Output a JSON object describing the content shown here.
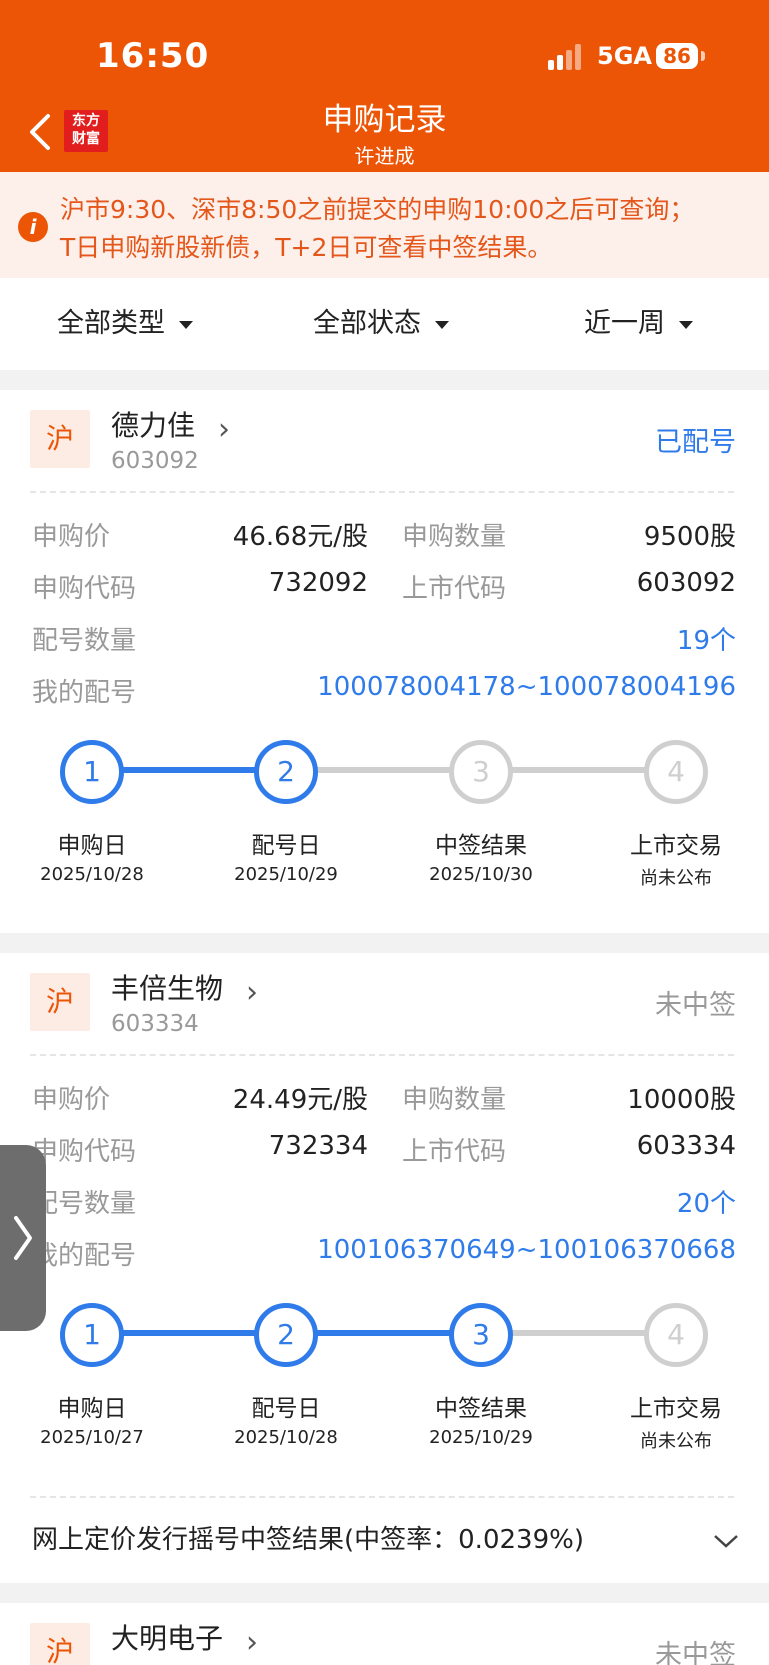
{
  "status_bar": {
    "time": "16:50",
    "network": "5GA",
    "battery": "86"
  },
  "header": {
    "title": "申购记录",
    "subtitle": "许进成",
    "logo": "东方财富"
  },
  "notice": {
    "line1": "沪市9:30、深市8:50之前提交的申购10:00之后可查询；",
    "line2": "T日申购新股新债，T+2日可查看中签结果。"
  },
  "filters": {
    "type": "全部类型",
    "status": "全部状态",
    "period": "近一周"
  },
  "labels": {
    "price": "申购价",
    "quantity": "申购数量",
    "sub_code": "申购代码",
    "list_code": "上市代码",
    "match_count": "配号数量",
    "my_numbers": "我的配号"
  },
  "records": [
    {
      "market": "沪",
      "name": "德力佳",
      "code": "603092",
      "status": "已配号",
      "status_color": "#2f7bea",
      "price": "46.68元/股",
      "quantity": "9500股",
      "sub_code": "732092",
      "list_code": "603092",
      "match_count": "19个",
      "my_numbers": "100078004178~100078004196",
      "steps": [
        {
          "num": "1",
          "label": "申购日",
          "date": "2025/10/28"
        },
        {
          "num": "2",
          "label": "配号日",
          "date": "2025/10/29"
        },
        {
          "num": "3",
          "label": "中签结果",
          "date": "2025/10/30"
        },
        {
          "num": "4",
          "label": "上市交易",
          "date": "尚未公布"
        }
      ],
      "current_step": 2
    },
    {
      "market": "沪",
      "name": "丰倍生物",
      "code": "603334",
      "status": "未中签",
      "status_color": "#999999",
      "price": "24.49元/股",
      "quantity": "10000股",
      "sub_code": "732334",
      "list_code": "603334",
      "match_count": "20个",
      "my_numbers": "100106370649~100106370668",
      "steps": [
        {
          "num": "1",
          "label": "申购日",
          "date": "2025/10/27"
        },
        {
          "num": "2",
          "label": "配号日",
          "date": "2025/10/28"
        },
        {
          "num": "3",
          "label": "中签结果",
          "date": "2025/10/29"
        },
        {
          "num": "4",
          "label": "上市交易",
          "date": "尚未公布"
        }
      ],
      "current_step": 3,
      "result_text": "网上定价发行摇号中签结果(中签率：0.0239%)"
    },
    {
      "market": "沪",
      "name": "大明电子",
      "status": "未中签"
    }
  ]
}
